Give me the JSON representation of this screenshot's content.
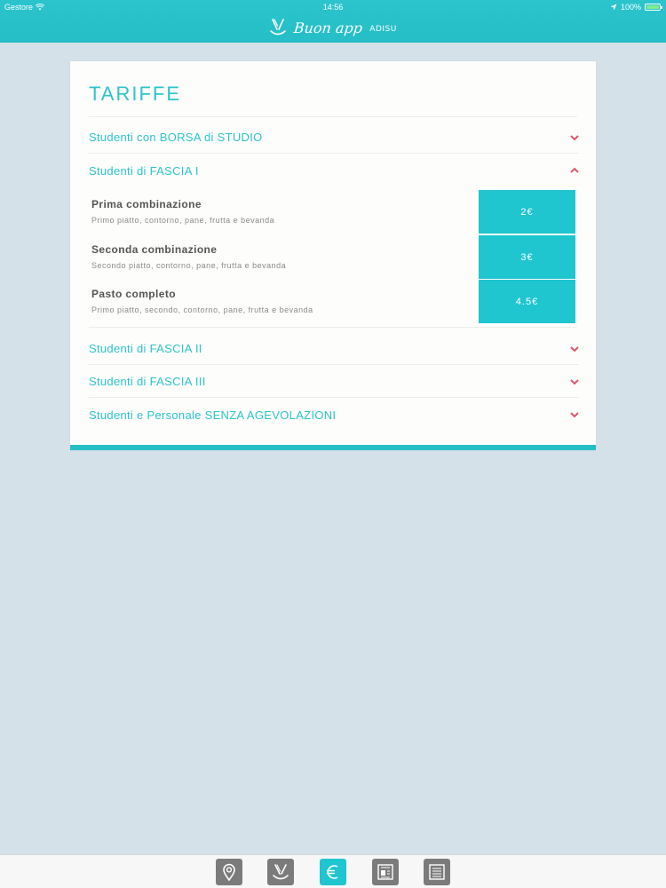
{
  "status_bar": {
    "carrier": "Gestore",
    "time": "14:56",
    "battery": "100%",
    "battery_level": 1.0
  },
  "header": {
    "app_name": "Buon app",
    "app_sub": "ADISU"
  },
  "page": {
    "title": "TARIFFE"
  },
  "sections": [
    {
      "label": "Studenti con BORSA di STUDIO",
      "expanded": false
    },
    {
      "label": "Studenti di FASCIA I",
      "expanded": true
    },
    {
      "label": "Studenti di FASCIA II",
      "expanded": false
    },
    {
      "label": "Studenti di FASCIA III",
      "expanded": false
    },
    {
      "label": "Studenti e Personale SENZA AGEVOLAZIONI",
      "expanded": false
    }
  ],
  "combinations": [
    {
      "name": "Prima combinazione",
      "description": "Primo piatto, contorno, pane, frutta e bevanda",
      "price": "2€"
    },
    {
      "name": "Seconda combinazione",
      "description": "Secondo piatto, contorno, pane, frutta e bevanda",
      "price": "3€"
    },
    {
      "name": "Pasto completo",
      "description": "Primo piatto, secondo, contorno, pane, frutta e bevanda",
      "price": "4.5€"
    }
  ],
  "tabs": [
    {
      "icon": "map-pin-icon",
      "active": false
    },
    {
      "icon": "fork-knife-icon",
      "active": false
    },
    {
      "icon": "euro-icon",
      "active": true
    },
    {
      "icon": "news-icon",
      "active": false
    },
    {
      "icon": "calendar-doc-icon",
      "active": false
    }
  ],
  "colors": {
    "accent": "#25bec7",
    "price_bg": "#1fc5cf",
    "chevron": "#e0566a",
    "background": "#d5e1e8",
    "tab_inactive": "#7b7b7b"
  }
}
